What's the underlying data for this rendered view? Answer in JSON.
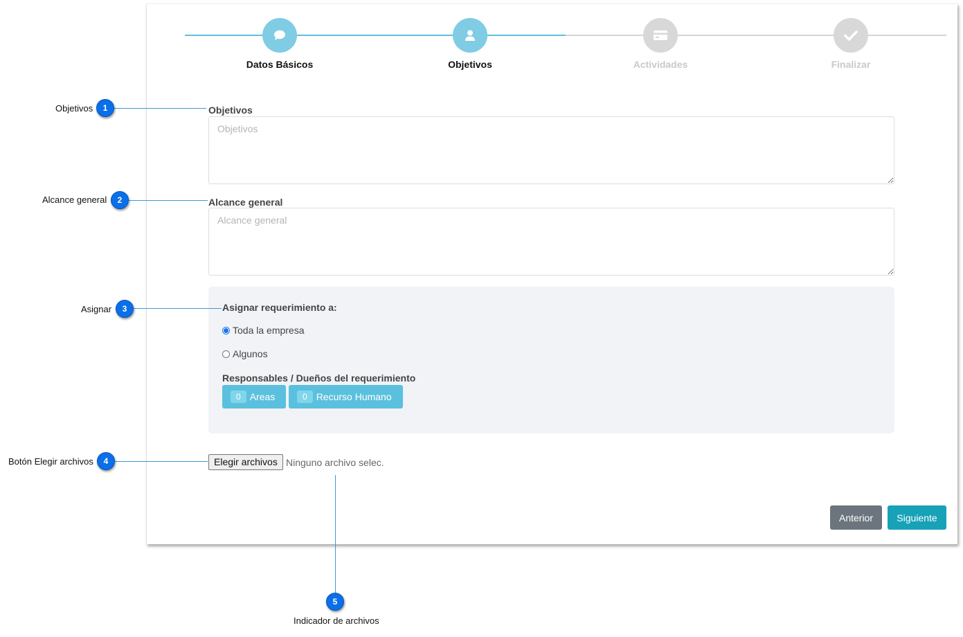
{
  "stepper": {
    "steps": [
      {
        "label": "Datos Básicos",
        "icon": "chat-bubble-icon",
        "state": "completed"
      },
      {
        "label": "Objetivos",
        "icon": "user-icon",
        "state": "current"
      },
      {
        "label": "Actividades",
        "icon": "credit-card-icon",
        "state": "pending"
      },
      {
        "label": "Finalizar",
        "icon": "check-icon",
        "state": "pending"
      }
    ]
  },
  "form": {
    "objetivos": {
      "label": "Objetivos",
      "placeholder": "Objetivos",
      "value": ""
    },
    "alcance": {
      "label": "Alcance general",
      "placeholder": "Alcance general",
      "value": ""
    },
    "assign": {
      "title": "Asignar requerimiento a:",
      "options": [
        {
          "label": "Toda la empresa",
          "checked": true
        },
        {
          "label": "Algunos",
          "checked": false
        }
      ],
      "owners_label": "Responsables / Dueños del requerimiento",
      "areas_count": "0",
      "areas_label": "Areas",
      "rh_count": "0",
      "rh_label": "Recurso Humano"
    },
    "file": {
      "button_label": "Elegir archivos",
      "status": "Ninguno archivo selec."
    }
  },
  "actions": {
    "prev_label": "Anterior",
    "next_label": "Siguiente"
  },
  "callouts": [
    {
      "number": "1",
      "label": "Objetivos"
    },
    {
      "number": "2",
      "label": "Alcance general"
    },
    {
      "number": "3",
      "label": "Asignar"
    },
    {
      "number": "4",
      "label": "Botón Elegir archivos"
    },
    {
      "number": "5",
      "label": "Indicador de archivos"
    }
  ],
  "colors": {
    "step_active": "#7fcce4",
    "step_inactive": "#d8d8d8",
    "info_button": "#5bc0de",
    "prev_button": "#6c757d",
    "next_button": "#17a2b8",
    "callout_badge": "#0a6fe8"
  }
}
